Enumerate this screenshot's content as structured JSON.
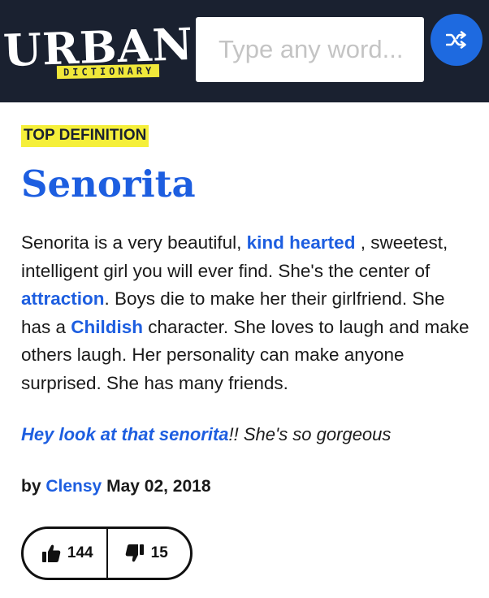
{
  "header": {
    "logo_word": "URBAN",
    "logo_sub": "DICTIONARY",
    "search_placeholder": "Type any word...",
    "random_icon": "shuffle-icon",
    "colors": {
      "background": "#1a2130",
      "accent": "#1e6ae0",
      "logo_strip": "#f0e83a"
    }
  },
  "definition": {
    "badge": "TOP DEFINITION",
    "word": "Senorita",
    "meaning": [
      {
        "text": "Senorita is a very beautiful, "
      },
      {
        "text": "kind hearted",
        "link": true
      },
      {
        "text": " , sweetest, intelligent girl you will ever find. She's the center of "
      },
      {
        "text": "attraction",
        "link": true
      },
      {
        "text": ". Boys die to make her their girlfriend. She has a "
      },
      {
        "text": "Childish",
        "link": true
      },
      {
        "text": " character. She loves to laugh and make others laugh. Her personality can make anyone surprised. She has many friends."
      }
    ],
    "example": [
      {
        "text": "Hey look at that senorita",
        "link": true
      },
      {
        "text": "!! She's so gorgeous"
      }
    ],
    "by_label": "by",
    "author": "Clensy",
    "date": "May 02, 2018",
    "thumbs_up": "144",
    "thumbs_down": "15",
    "colors": {
      "link": "#1d5ee0",
      "badge": "#f5ef3a"
    }
  }
}
